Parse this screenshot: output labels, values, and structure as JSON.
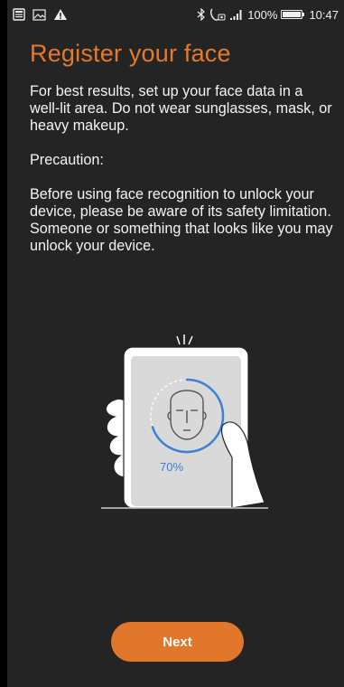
{
  "status_bar": {
    "left_icons": [
      "news-icon",
      "image-icon",
      "warning-icon"
    ],
    "right_icons": [
      "bluetooth-icon",
      "call-icon",
      "signal-icon",
      "battery-icon"
    ],
    "battery_percent": "100%",
    "battery_level": 1.0,
    "time": "10:47"
  },
  "page": {
    "title": "Register your face",
    "paragraph_1": "For best results, set up your face data in a well-lit area. Do not wear sunglasses, mask, or heavy makeup.",
    "paragraph_2": "Precaution:",
    "paragraph_3": "Before using face recognition to unlock your device, please be aware of its safety limitation. Someone or something that looks like you may unlock your device."
  },
  "illustration": {
    "progress_label": "70%",
    "progress_value": 0.7,
    "accent": "#3b82d6"
  },
  "actions": {
    "next_label": "Next"
  },
  "colors": {
    "background": "#242424",
    "title": "#e37a2c",
    "button": "#e1772a"
  }
}
